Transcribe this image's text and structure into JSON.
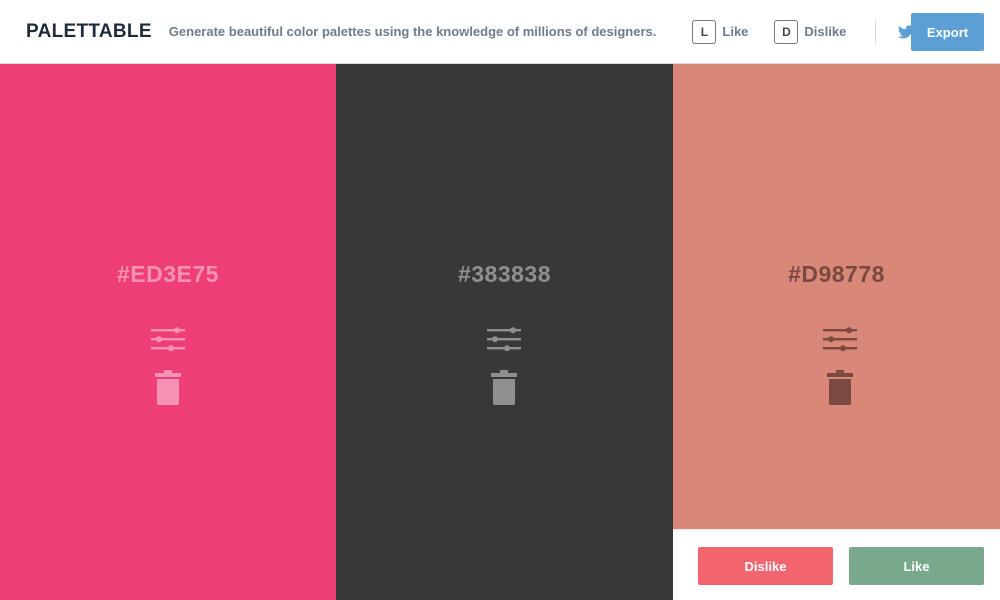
{
  "header": {
    "brand": "PALETTABLE",
    "tagline": "Generate beautiful color palettes using the knowledge of millions of designers.",
    "like_key": "L",
    "like_label": "Like",
    "dislike_key": "D",
    "dislike_label": "Dislike",
    "twitter_icon": "twitter-icon",
    "export_label": "Export"
  },
  "colors": {
    "header_text": "#1f2b3a",
    "muted_text": "#6f7c8b",
    "export_button": "#5b9fd4",
    "twitter": "#5b9fd4",
    "dislike_button": "#f2646e",
    "like_button": "#79a98c"
  },
  "swatches": [
    {
      "hex": "#ED3E75",
      "bg": "#ED3E75",
      "fg": "#f592b4"
    },
    {
      "hex": "#383838",
      "bg": "#383838",
      "fg": "#8f8f8f"
    },
    {
      "hex": "#D98778",
      "bg": "#D98778",
      "fg": "#7a4a42"
    }
  ],
  "swatch_icons": [
    "adjust-sliders-icon",
    "trash-icon"
  ],
  "vote": {
    "dislike_label": "Dislike",
    "like_label": "Like"
  }
}
